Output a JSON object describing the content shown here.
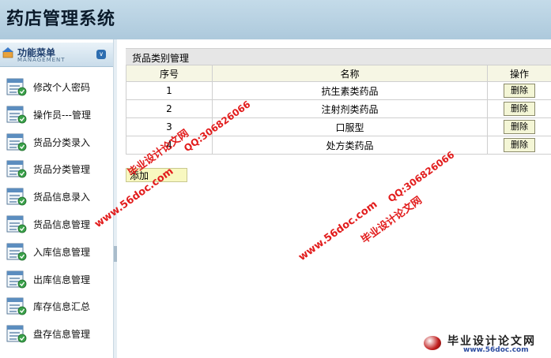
{
  "app": {
    "title": "药店管理系统"
  },
  "menu": {
    "title": "功能菜单",
    "subtitle": "MANAGEMENT",
    "items": [
      {
        "label": "修改个人密码"
      },
      {
        "label": "操作员---管理"
      },
      {
        "label": "货品分类录入"
      },
      {
        "label": "货品分类管理"
      },
      {
        "label": "货品信息录入"
      },
      {
        "label": "货品信息管理"
      },
      {
        "label": "入库信息管理"
      },
      {
        "label": "出库信息管理"
      },
      {
        "label": "库存信息汇总"
      },
      {
        "label": "盘存信息管理"
      }
    ]
  },
  "panel": {
    "title": "货品类别管理",
    "columns": [
      "序号",
      "名称",
      "操作"
    ],
    "rows": [
      {
        "id": "1",
        "name": "抗生素类药品",
        "action": "删除"
      },
      {
        "id": "2",
        "name": "注射剂类药品",
        "action": "删除"
      },
      {
        "id": "3",
        "name": "口服型",
        "action": "删除"
      },
      {
        "id": "4",
        "name": "处方类药品",
        "action": "删除"
      }
    ],
    "add_label": "添加"
  },
  "watermark": {
    "site": "www.56doc.com",
    "qq": "QQ:306826066",
    "name": "毕业设计论文网"
  },
  "logo": {
    "title": "毕业设计论文网",
    "url": "www.56doc.com"
  },
  "colors": {
    "header": "#b8d2e4",
    "watermark": "#e21d1d",
    "button": "#f4f6d6",
    "table_head": "#f6f6e4"
  }
}
